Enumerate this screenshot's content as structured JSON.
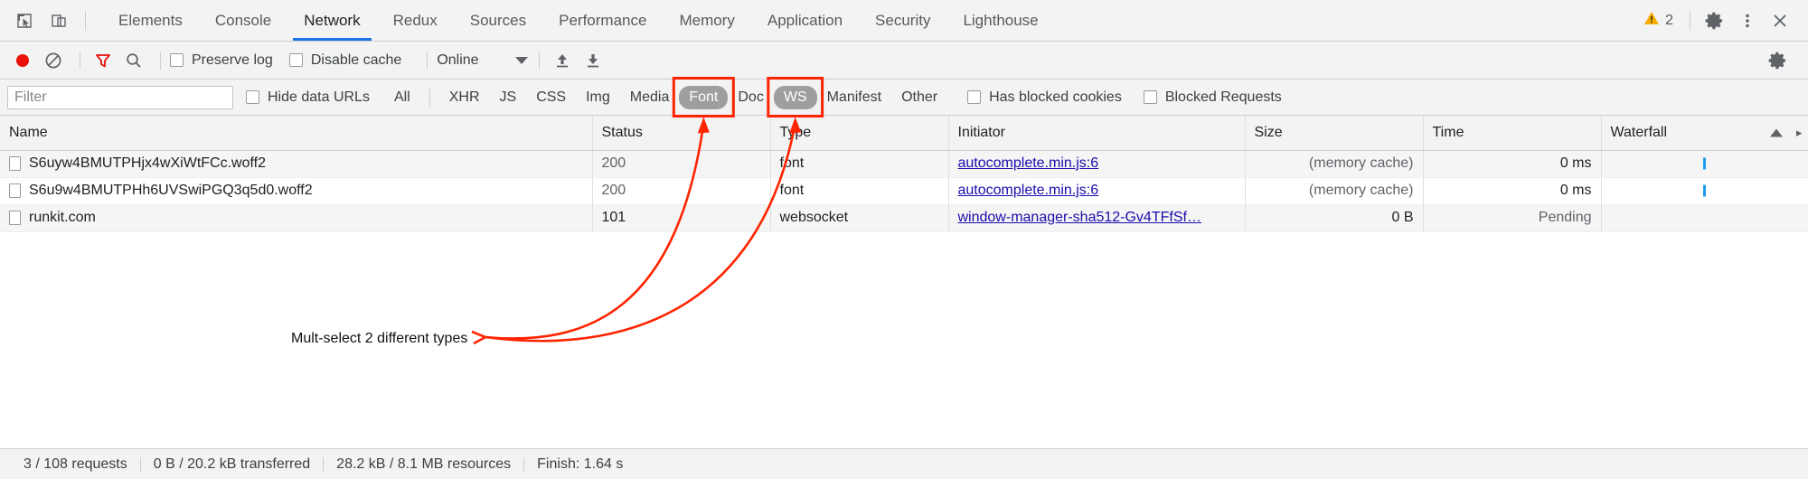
{
  "window": {
    "title": "Chrome DevTools - Network"
  },
  "tabbar": {
    "inspect_icon": "inspect-element-icon",
    "device_icon": "device-toolbar-icon",
    "tabs": [
      {
        "label": "Elements",
        "selected": false
      },
      {
        "label": "Console",
        "selected": false
      },
      {
        "label": "Network",
        "selected": true
      },
      {
        "label": "Redux",
        "selected": false
      },
      {
        "label": "Sources",
        "selected": false
      },
      {
        "label": "Performance",
        "selected": false
      },
      {
        "label": "Memory",
        "selected": false
      },
      {
        "label": "Application",
        "selected": false
      },
      {
        "label": "Security",
        "selected": false
      },
      {
        "label": "Lighthouse",
        "selected": false
      }
    ],
    "warning_count": "2",
    "warning_icon": "warning-triangle-icon",
    "settings_icon": "gear-icon",
    "more_icon": "kebab-menu-icon",
    "close_icon": "close-icon",
    "accent_color": "#1a73e8",
    "warning_color": "#f9ab00"
  },
  "toolbar": {
    "record_icon": "record-button-icon",
    "record_color": "#e8110b",
    "clear_icon": "clear-icon",
    "filter_icon": "filter-funnel-icon",
    "filter_active_color": "#e8110b",
    "search_icon": "search-icon",
    "preserve_log_label": "Preserve log",
    "preserve_log_checked": false,
    "disable_cache_label": "Disable cache",
    "disable_cache_checked": false,
    "throttle_value": "Online",
    "import_icon": "import-har-icon",
    "export_icon": "export-har-icon",
    "settings_icon": "gear-icon"
  },
  "filterbar": {
    "filter_placeholder": "Filter",
    "filter_value": "",
    "hide_data_urls_label": "Hide data URLs",
    "hide_data_urls_checked": false,
    "types": [
      {
        "label": "All",
        "active": false
      },
      {
        "label": "XHR",
        "active": false
      },
      {
        "label": "JS",
        "active": false
      },
      {
        "label": "CSS",
        "active": false
      },
      {
        "label": "Img",
        "active": false
      },
      {
        "label": "Media",
        "active": false
      },
      {
        "label": "Font",
        "active": true
      },
      {
        "label": "Doc",
        "active": false
      },
      {
        "label": "WS",
        "active": true
      },
      {
        "label": "Manifest",
        "active": false
      },
      {
        "label": "Other",
        "active": false
      }
    ],
    "has_blocked_cookies_label": "Has blocked cookies",
    "has_blocked_cookies_checked": false,
    "blocked_requests_label": "Blocked Requests",
    "blocked_requests_checked": false
  },
  "table": {
    "columns": [
      {
        "key": "name",
        "label": "Name"
      },
      {
        "key": "status",
        "label": "Status"
      },
      {
        "key": "type",
        "label": "Type"
      },
      {
        "key": "initiator",
        "label": "Initiator"
      },
      {
        "key": "size",
        "label": "Size"
      },
      {
        "key": "time",
        "label": "Time"
      },
      {
        "key": "waterfall",
        "label": "Waterfall"
      }
    ],
    "sort_indicator": "ascending-sort-arrow",
    "rows": [
      {
        "name": "S6uyw4BMUTPHjx4wXiWtFCc.woff2",
        "status": "200",
        "type": "font",
        "initiator": "autocomplete.min.js:6",
        "size": "(memory cache)",
        "time": "0 ms",
        "waterfall": "bar"
      },
      {
        "name": "S6u9w4BMUTPHh6UVSwiPGQ3q5d0.woff2",
        "status": "200",
        "type": "font",
        "initiator": "autocomplete.min.js:6",
        "size": "(memory cache)",
        "time": "0 ms",
        "waterfall": "bar"
      },
      {
        "name": "runkit.com",
        "status": "101",
        "type": "websocket",
        "initiator": "window-manager-sha512-Gv4TFfSf…",
        "size": "0 B",
        "time": "Pending",
        "waterfall": ""
      }
    ]
  },
  "statusbar": {
    "items": [
      "3 / 108 requests",
      "0 B / 20.2 kB transferred",
      "28.2 kB / 8.1 MB resources",
      "Finish: 1.64 s"
    ]
  },
  "annotations": {
    "color": "#ff2400",
    "callout_text": "Mult-select 2 different types",
    "highlight_boxes": [
      "font-filter-button",
      "ws-filter-button"
    ]
  }
}
